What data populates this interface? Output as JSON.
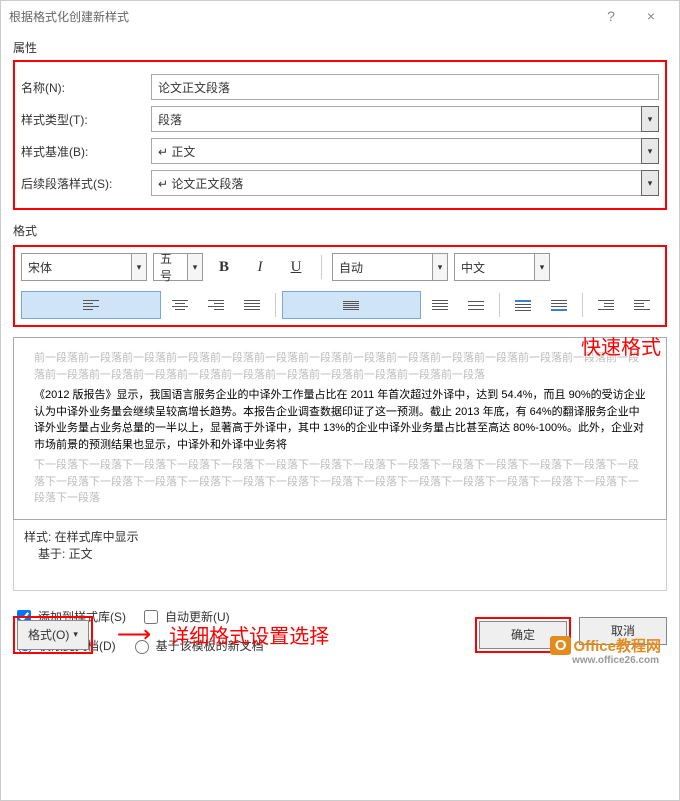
{
  "window": {
    "title": "根据格式化创建新样式",
    "help": "?",
    "close": "×"
  },
  "sections": {
    "properties": "属性",
    "format": "格式"
  },
  "props": {
    "name_label": "名称(N):",
    "name_value": "论文正文段落",
    "type_label": "样式类型(T):",
    "type_value": "段落",
    "base_label": "样式基准(B):",
    "base_value": "↵ 正文",
    "next_label": "后续段落样式(S):",
    "next_value": "↵ 论文正文段落"
  },
  "toolbar": {
    "font": "宋体",
    "size": "五号",
    "bold": "B",
    "italic": "I",
    "underline": "U",
    "color": "自动",
    "lang": "中文"
  },
  "annotations": {
    "quick_format": "快速格式",
    "detail_format": "详细格式设置选择",
    "arrow": "⟶"
  },
  "preview": {
    "before": "前一段落前一段落前一段落前一段落前一段落前一段落前一段落前一段落前一段落前一段落前一段落前一段落前一段落前一段落前一段落前一段落前一段落前一段落前一段落前一段落前一段落前一段落前一段落前一段落",
    "body": "《2012 版报告》显示，我国语言服务企业的中译外工作量占比在 2011 年首次超过外译中，达到 54.4%，而且 90%的受访企业认为中译外业务量会继续呈较高增长趋势。本报告企业调查数据印证了这一预测。截止 2013 年底，有 64%的翻译服务企业中译外业务量占业务总量的一半以上，显著高于外译中，其中 13%的企业中译外业务量占比甚至高达 80%-100%。此外，企业对市场前景的预测结果也显示，中译外和外译中业务将",
    "after": "下一段落下一段落下一段落下一段落下一段落下一段落下一段落下一段落下一段落下一段落下一段落下一段落下一段落下一段落下一段落下一段落下一段落下一段落下一段落下一段落下一段落下一段落下一段落下一段落下一段落下一段落下一段落下一段落下一段落"
  },
  "style_info": {
    "line1": "样式: 在样式库中显示",
    "line2": "基于: 正文"
  },
  "options": {
    "add_gallery": "添加到样式库(S)",
    "auto_update": "自动更新(U)",
    "this_doc": "仅限此文档(D)",
    "template": "基于该模板的新文档"
  },
  "buttons": {
    "format_menu": "格式(O)",
    "ok": "确定",
    "cancel": "取消"
  },
  "overlay": {
    "logo_letter": "O",
    "text": "Office教程网",
    "url": "www.office26.com"
  }
}
